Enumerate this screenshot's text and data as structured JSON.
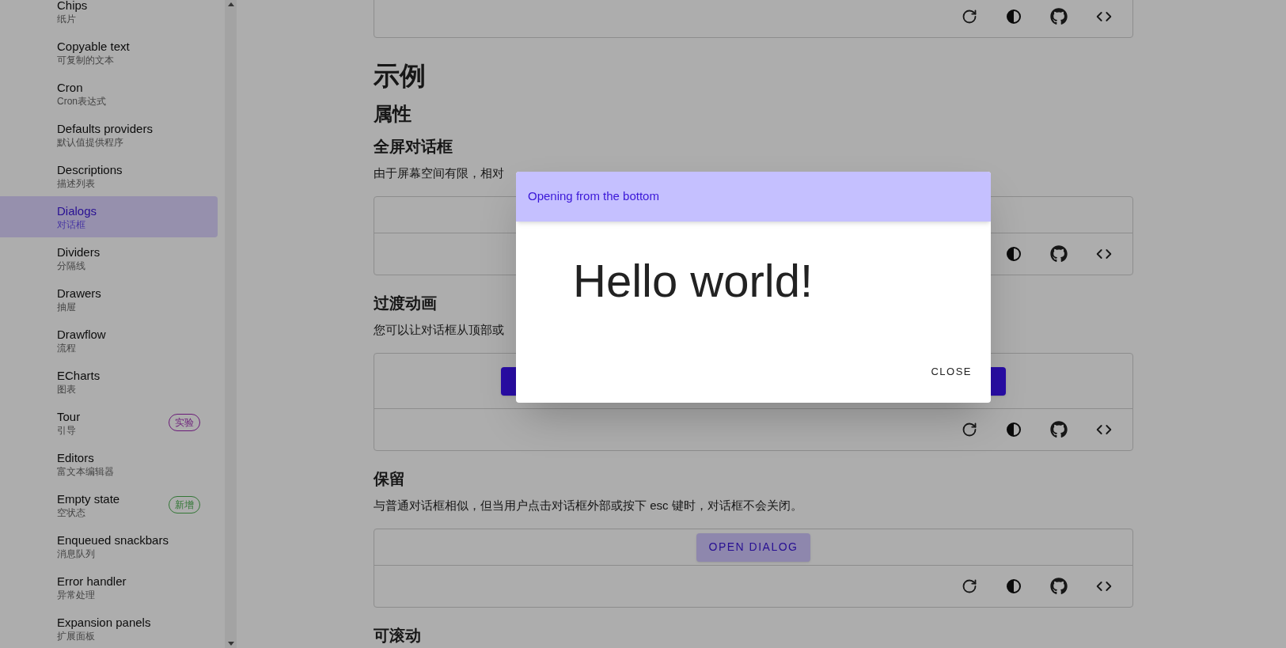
{
  "sidebar": {
    "items": [
      {
        "title": "Chips",
        "subtitle": "纸片",
        "selected": false
      },
      {
        "title": "Copyable text",
        "subtitle": "可复制的文本",
        "selected": false
      },
      {
        "title": "Cron",
        "subtitle": "Cron表达式",
        "selected": false
      },
      {
        "title": "Defaults providers",
        "subtitle": "默认值提供程序",
        "selected": false
      },
      {
        "title": "Descriptions",
        "subtitle": "描述列表",
        "selected": false
      },
      {
        "title": "Dialogs",
        "subtitle": "对话框",
        "selected": true
      },
      {
        "title": "Dividers",
        "subtitle": "分隔线",
        "selected": false
      },
      {
        "title": "Drawers",
        "subtitle": "抽屉",
        "selected": false
      },
      {
        "title": "Drawflow",
        "subtitle": "流程",
        "selected": false
      },
      {
        "title": "ECharts",
        "subtitle": "图表",
        "selected": false
      },
      {
        "title": "Tour",
        "subtitle": "引导",
        "selected": false,
        "badge": {
          "label": "实验",
          "color": "#6a1a78"
        }
      },
      {
        "title": "Editors",
        "subtitle": "富文本编辑器",
        "selected": false
      },
      {
        "title": "Empty state",
        "subtitle": "空状态",
        "selected": false,
        "badge": {
          "label": "新增",
          "color": "#337736"
        }
      },
      {
        "title": "Enqueued snackbars",
        "subtitle": "消息队列",
        "selected": false
      },
      {
        "title": "Error handler",
        "subtitle": "异常处理",
        "selected": false
      },
      {
        "title": "Expansion panels",
        "subtitle": "扩展面板",
        "selected": false
      }
    ]
  },
  "content": {
    "heading": "示例",
    "subheading": "属性",
    "sections": [
      {
        "title": "全屏对话框",
        "description": "由于屏幕空间有限，相对",
        "demo": {
          "kind": "hidden"
        }
      },
      {
        "title": "过渡动画",
        "description": "您可以让对话框从顶部或",
        "demo": {
          "kind": "pair"
        }
      },
      {
        "title": "保留",
        "description": "与普通对话框相似，但当用户点击对话框外部或按下 esc 键时，对话框不会关闭。",
        "demo": {
          "kind": "button",
          "label": "OPEN DIALOG"
        }
      },
      {
        "title": "可滚动"
      }
    ]
  },
  "dialog": {
    "title": "Opening from the bottom",
    "body": "Hello world!",
    "action": "CLOSE"
  }
}
